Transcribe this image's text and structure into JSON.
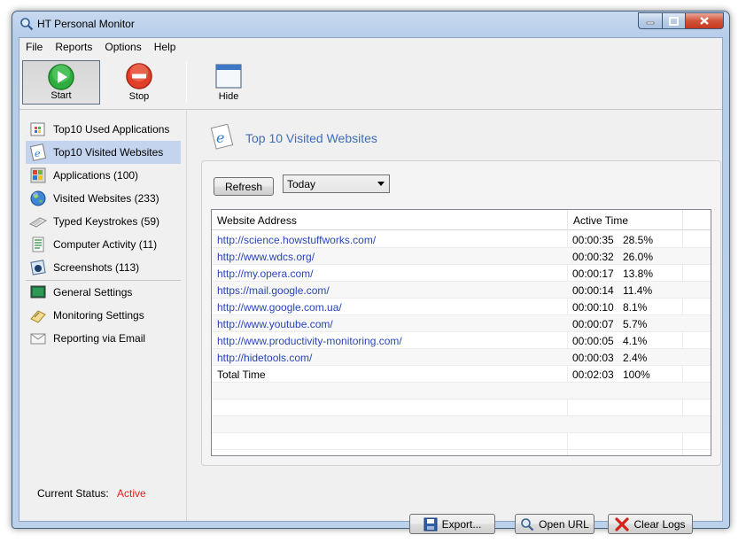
{
  "window": {
    "title": "HT Personal Monitor"
  },
  "menu": [
    "File",
    "Reports",
    "Options",
    "Help"
  ],
  "toolbar": {
    "start": "Start",
    "stop": "Stop",
    "hide": "Hide"
  },
  "sidebar": {
    "items": [
      {
        "label": "Top10 Used Applications",
        "icon": "apps-icon"
      },
      {
        "label": "Top10 Visited Websites",
        "icon": "ie-icon",
        "selected": true
      },
      {
        "label": "Applications (100)",
        "icon": "windows-icon"
      },
      {
        "label": "Visited Websites (233)",
        "icon": "globe-icon"
      },
      {
        "label": "Typed Keystrokes (59)",
        "icon": "keyboard-icon"
      },
      {
        "label": "Computer Activity (11)",
        "icon": "activity-icon"
      },
      {
        "label": "Screenshots (113)",
        "icon": "screenshot-icon"
      },
      {
        "label": "General Settings",
        "icon": "settings-icon"
      },
      {
        "label": "Monitoring Settings",
        "icon": "monitor-settings-icon"
      },
      {
        "label": "Reporting via Email",
        "icon": "email-icon"
      }
    ],
    "status_label": "Current Status:",
    "status_value": "Active"
  },
  "main": {
    "title": "Top 10 Visited Websites",
    "refresh": "Refresh",
    "period": "Today",
    "columns": [
      "Website Address",
      "Active Time"
    ],
    "rows": [
      {
        "url": "http://science.howstuffworks.com/",
        "time": "00:00:35",
        "pct": "28.5%"
      },
      {
        "url": "http://www.wdcs.org/",
        "time": "00:00:32",
        "pct": "26.0%"
      },
      {
        "url": "http://my.opera.com/",
        "time": "00:00:17",
        "pct": "13.8%"
      },
      {
        "url": "https://mail.google.com/",
        "time": "00:00:14",
        "pct": "11.4%"
      },
      {
        "url": "http://www.google.com.ua/",
        "time": "00:00:10",
        "pct": "8.1%"
      },
      {
        "url": "http://www.youtube.com/",
        "time": "00:00:07",
        "pct": "5.7%"
      },
      {
        "url": "http://www.productivity-monitoring.com/",
        "time": "00:00:05",
        "pct": "4.1%"
      },
      {
        "url": "http://hidetools.com/",
        "time": "00:00:03",
        "pct": "2.4%"
      },
      {
        "url": "Total Time",
        "time": "00:02:03",
        "pct": "100%"
      }
    ],
    "export": "Export...",
    "open_url": "Open URL",
    "clear_logs": "Clear Logs"
  }
}
